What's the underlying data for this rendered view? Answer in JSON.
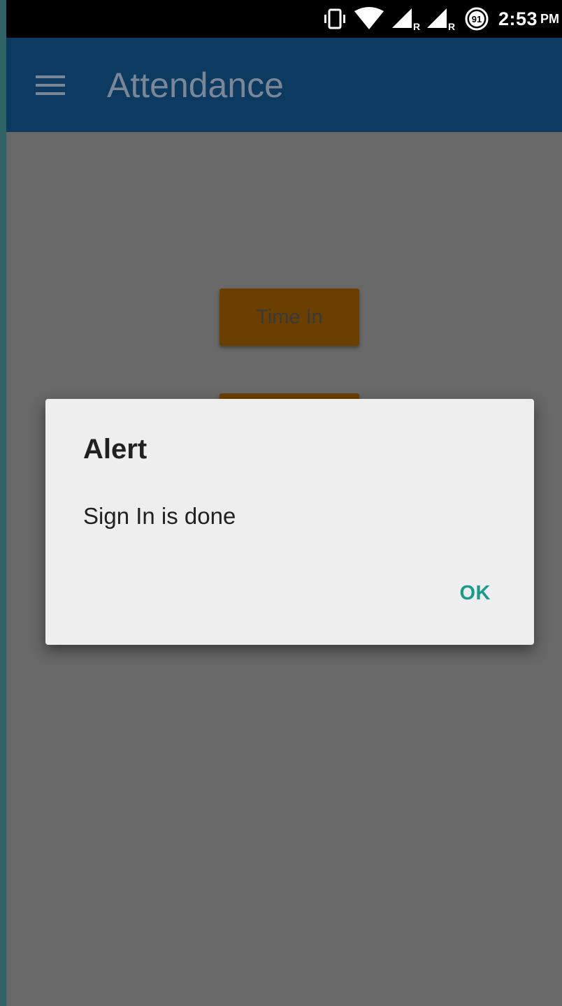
{
  "status_bar": {
    "icons": [
      "vibrate-icon",
      "wifi-icon",
      "signal-roaming-icon",
      "signal-roaming-icon",
      "battery-icon"
    ],
    "roaming_label": "R",
    "battery_level": "91",
    "time": "2:53",
    "ampm": "PM"
  },
  "app_bar": {
    "menu_icon": "hamburger-menu-icon",
    "title": "Attendance",
    "background": "#0c3a61"
  },
  "main": {
    "time_in_label": "Time In",
    "button_color": "#6b3f00"
  },
  "dialog": {
    "title": "Alert",
    "message": "Sign In is done",
    "ok_label": "OK",
    "ok_color": "#1a9a8a"
  }
}
